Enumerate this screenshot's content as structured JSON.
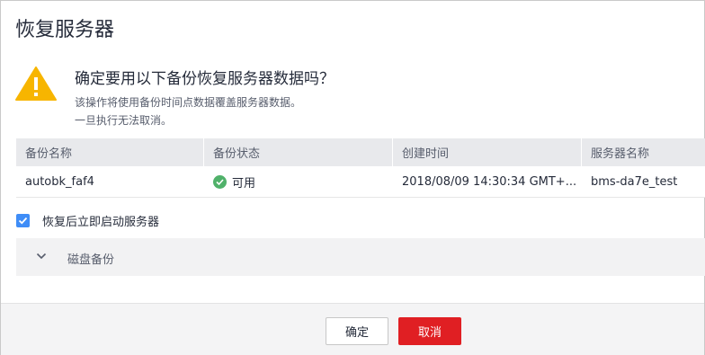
{
  "dialog": {
    "title": "恢复服务器",
    "question": "确定要用以下备份恢复服务器数据吗？",
    "description_line1": "该操作将使用备份时间点数据覆盖服务器数据。",
    "description_line2": "一旦执行无法取消。"
  },
  "table": {
    "headers": [
      "备份名称",
      "备份状态",
      "创建时间",
      "服务器名称"
    ],
    "rows": [
      {
        "name": "autobk_faf4",
        "status": "可用",
        "created": "2018/08/09 14:30:34 GMT+...",
        "server": "bms-da7e_test"
      }
    ]
  },
  "options": {
    "start_after_restore_label": "恢复后立即启动服务器",
    "start_after_restore_checked": true
  },
  "collapse": {
    "label": "磁盘备份",
    "expanded": false
  },
  "buttons": {
    "confirm": "确定",
    "cancel": "取消"
  },
  "colors": {
    "accent": "#3f8df7",
    "danger": "#e01f23",
    "success": "#50b16a",
    "warning": "#f7b500"
  },
  "icons": {
    "warning": "warning-triangle-icon",
    "status_ok": "check-circle-icon",
    "checkbox": "check-icon",
    "collapse": "chevron-down-icon"
  }
}
